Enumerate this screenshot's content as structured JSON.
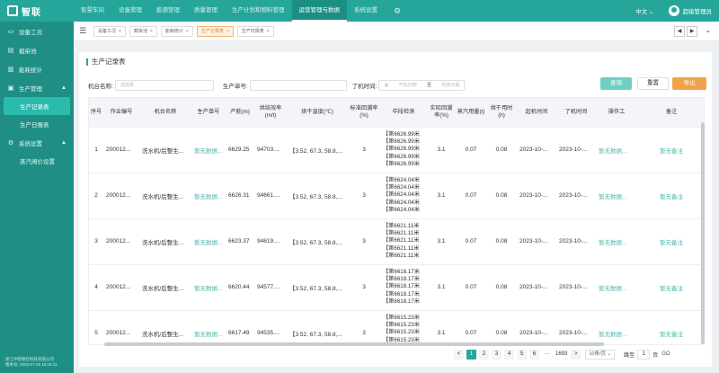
{
  "topbar": {
    "nav": [
      {
        "label": "智慧车间"
      },
      {
        "label": "设备管理"
      },
      {
        "label": "能源管理"
      },
      {
        "label": "质量管理"
      },
      {
        "label": "生产计划和物料管理"
      },
      {
        "label": "运营管理与数据"
      },
      {
        "label": "系统设置"
      }
    ],
    "active_index": 5,
    "lang": "中文",
    "user": "超级管理员"
  },
  "sidebar": {
    "items": [
      {
        "label": "设备工况",
        "icon": "monitor-icon"
      },
      {
        "label": "截染池",
        "icon": "chart-icon"
      },
      {
        "label": "能耗统计",
        "icon": "bar-chart-icon"
      },
      {
        "label": "生产管理",
        "icon": "doc-icon",
        "expanded": true
      }
    ],
    "production_sub": [
      {
        "label": "生产记录表",
        "active": true
      },
      {
        "label": "生产日报表",
        "active": false
      }
    ],
    "system": {
      "label": "系统设置",
      "icon": "gear-icon"
    },
    "system_sub": [
      {
        "label": "蒸汽阀价设置"
      }
    ],
    "footer_company": "浙江中智联控科技有限公司",
    "footer_version": "版本号: 2023-07-28 16:19:11"
  },
  "tags": [
    {
      "label": "设备工况",
      "active": false
    },
    {
      "label": "截染池",
      "active": false
    },
    {
      "label": "能耗统计",
      "active": false
    },
    {
      "label": "生产记录表",
      "active": true
    },
    {
      "label": "生产日报表",
      "active": false
    }
  ],
  "page": {
    "title": "生产记录表",
    "filters": {
      "machine_label": "机台名称:",
      "machine_placeholder": "请选择",
      "order_label": "生产单号:",
      "end_label": "了机时间:",
      "start_placeholder": "开始日期",
      "to": "至",
      "end_placeholder": "结束日期"
    },
    "buttons": {
      "query": "查询",
      "reset": "重置",
      "export": "导出"
    }
  },
  "table": {
    "headers": [
      "序号",
      "作业编号",
      "机台名称",
      "生产单号",
      "产能(m)",
      "烘焙效率(m/t)",
      "烘干温度(℃)",
      "标准回潮率(%)",
      "中段检测",
      "实际回潮率(%)",
      "蒸汽用量(t)",
      "烘干用时(h)",
      "起机时间",
      "了机时间",
      "操作工",
      "备注"
    ],
    "rows": [
      {
        "no": "1",
        "job": "200012...",
        "machine": "洗水机/后整生...",
        "order": "暂无数据...",
        "output": "6629.25",
        "eff": "94703....",
        "temp": "【3.52, 67.3, 58.8,...",
        "std": "3",
        "mid": [
          "【第6626.99米",
          "【第6626.99米",
          "【第6626.99米",
          "【第6626.99米",
          "【第6626.99米"
        ],
        "actual": "3.1",
        "steam": "0.07",
        "dry": "0.08",
        "start": "2023-10-...",
        "end": "2023-10-...",
        "op": "暂无数据...",
        "note": "暂无备注"
      },
      {
        "no": "2",
        "job": "200012...",
        "machine": "洗水机/后整生...",
        "order": "暂无数据...",
        "output": "6626.31",
        "eff": "94661....",
        "temp": "【3.52, 67.3, 58.8,...",
        "std": "3",
        "mid": [
          "【第6624.04米",
          "【第6624.04米",
          "【第6624.04米",
          "【第6624.04米",
          "【第6624.04米"
        ],
        "actual": "3.1",
        "steam": "0.07",
        "dry": "0.08",
        "start": "2023-10-...",
        "end": "2023-10-...",
        "op": "暂无数据...",
        "note": "暂无备注"
      },
      {
        "no": "3",
        "job": "200012...",
        "machine": "洗水机/后整生...",
        "order": "暂无数据...",
        "output": "6623.37",
        "eff": "94619....",
        "temp": "【3.52, 67.3, 58.8,...",
        "std": "3",
        "mid": [
          "【第6621.11米",
          "【第6621.11米",
          "【第6621.11米",
          "【第6621.11米",
          "【第6621.11米"
        ],
        "actual": "3.1",
        "steam": "0.07",
        "dry": "0.08",
        "start": "2023-10-...",
        "end": "2023-10-...",
        "op": "暂无数据...",
        "note": "暂无备注"
      },
      {
        "no": "4",
        "job": "200012...",
        "machine": "洗水机/后整生...",
        "order": "暂无数据...",
        "output": "6620.44",
        "eff": "94577....",
        "temp": "【3.52, 67.3, 58.8,...",
        "std": "3",
        "mid": [
          "【第6618.17米",
          "【第6618.17米",
          "【第6618.17米",
          "【第6618.17米",
          "【第6618.17米"
        ],
        "actual": "3.1",
        "steam": "0.07",
        "dry": "0.08",
        "start": "2023-10-...",
        "end": "2023-10-...",
        "op": "暂无数据...",
        "note": "暂无备注"
      },
      {
        "no": "5",
        "job": "200012...",
        "machine": "洗水机/后整生...",
        "order": "暂无数据...",
        "output": "6617.49",
        "eff": "94535....",
        "temp": "【3.52, 67.3, 58.8,...",
        "std": "3",
        "mid": [
          "【第6615.23米",
          "【第6615.23米",
          "【第6615.23米",
          "【第6615.23米",
          "【第6615.23米"
        ],
        "actual": "3.1",
        "steam": "0.07",
        "dry": "0.08",
        "start": "2023-10-...",
        "end": "2023-10-...",
        "op": "暂无数据...",
        "note": "暂无备注"
      }
    ]
  },
  "pagination": {
    "prev": "<",
    "pages": [
      "1",
      "2",
      "3",
      "4",
      "5",
      "6"
    ],
    "ellipsis": "···",
    "last": "1693",
    "next": ">",
    "size": "10条/页",
    "jump_label": "跳至",
    "jump_value": "1",
    "page_suffix": "页",
    "go": "GO"
  },
  "colors": {
    "primary": "#26a69a",
    "sidebar": "#1f8f85",
    "export": "#f0a348",
    "link": "#4db6ac"
  }
}
